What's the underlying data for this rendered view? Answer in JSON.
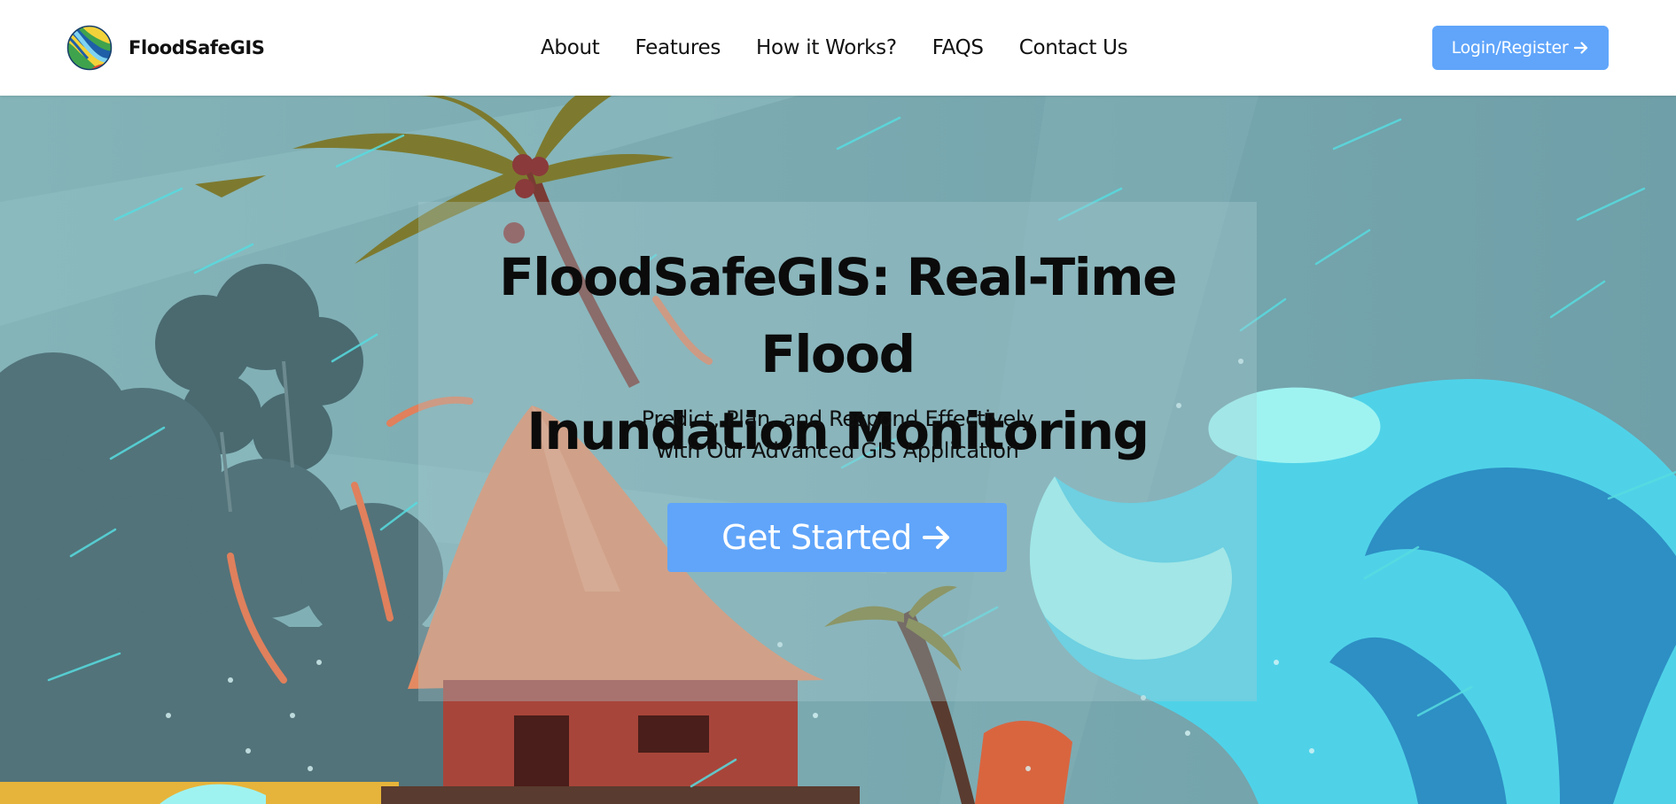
{
  "brand": {
    "name": "FloodSafeGIS",
    "logo_icon": "globe-logo-icon"
  },
  "nav": {
    "links": [
      "About",
      "Features",
      "How it Works?",
      "FAQS",
      "Contact Us"
    ],
    "login_label": "Login/Register",
    "login_icon": "arrow-right-icon"
  },
  "hero": {
    "title_line1": "FloodSafeGIS: Real-Time Flood",
    "title_line2": "Inundation Monitoring",
    "subtitle_line1": "Predict, Plan, and Respond Effectively",
    "subtitle_line2": "with Our Advanced GIS Application",
    "cta_label": "Get Started",
    "cta_icon": "arrow-right-icon"
  },
  "colors": {
    "accent": "#60a5fa",
    "navbar_bg": "#ffffff",
    "hero_sky": "#7aa6ac",
    "text_dark": "#111111"
  }
}
